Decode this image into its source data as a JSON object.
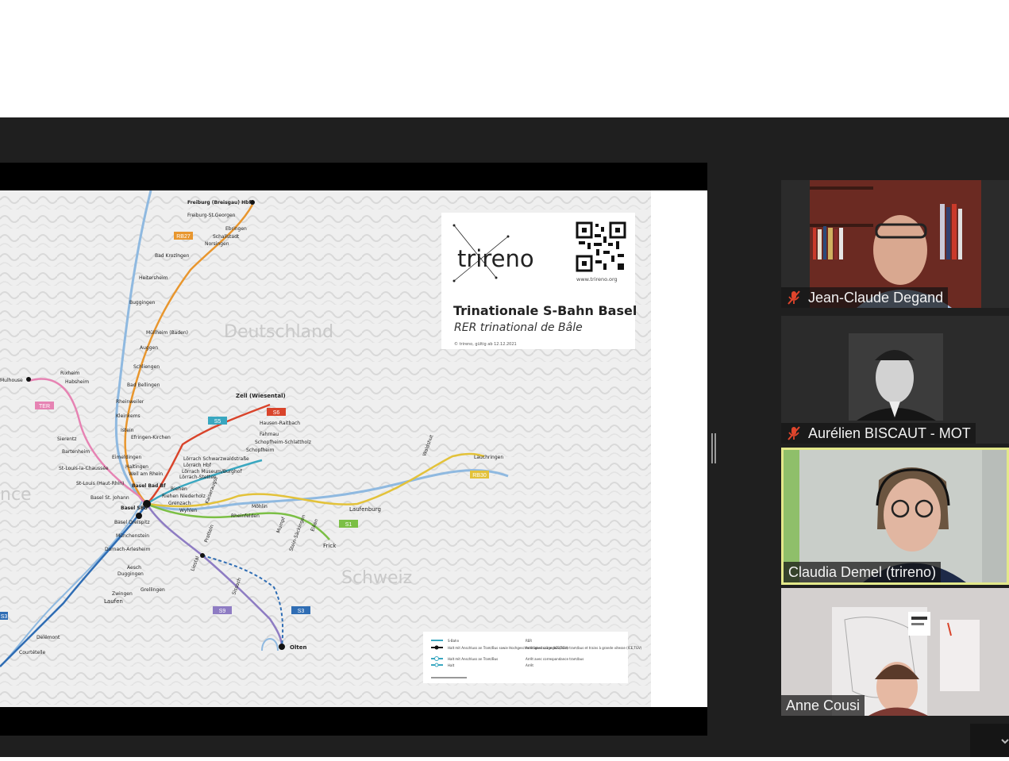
{
  "colors": {
    "meeting_bg": "#1f1f1f",
    "active_speaker_border": "#e3e88a",
    "mute_icon": "#e0452c",
    "line_orange": "#e8962e",
    "line_pink": "#e683b3",
    "line_green": "#7bbf45",
    "line_teal": "#39a7c0",
    "line_yellow": "#e3c23a",
    "line_red": "#d9442b",
    "line_purple": "#8e7cc3",
    "line_blue": "#2f6db4"
  },
  "shared_slide": {
    "logo_text": "trireno",
    "website": "www.trireno.org",
    "title": "Trinationale S-Bahn Basel",
    "subtitle": "RER trinational de Bâle",
    "validity": "© trireno, gültig ab 12.12.2021",
    "region_labels": {
      "germany": "Deutschland",
      "switzerland": "Schweiz",
      "france": "nce"
    },
    "line_badges": {
      "rb27": "RB27",
      "ter": "TER",
      "s5": "S5",
      "s6": "S6",
      "s1": "S1",
      "s3": "S3",
      "s9": "S9",
      "rb30": "RB30",
      "s3_left": "S3"
    },
    "stations": {
      "freiburg": "Freiburg (Breisgau) Hbf",
      "freiburg_st_georgen": "Freiburg-St.Georgen",
      "ebringen": "Ebringen",
      "schallstadt": "Schallstadt",
      "norsingen": "Norsingen",
      "bad_krozingen": "Bad Krozingen",
      "heitersheim": "Heitersheim",
      "buggingen": "Buggingen",
      "muellheim": "Müllheim (Baden)",
      "auggen": "Auggen",
      "schliengen": "Schliengen",
      "bad_bellingen": "Bad Bellingen",
      "rheinweiler": "Rheinweiler",
      "kleinkems": "Kleinkems",
      "istein": "Istein",
      "efringen": "Efringen-Kirchen",
      "eimeldingen": "Eimeldingen",
      "haltingen": "Haltingen",
      "weil_am_rhein": "Weil am Rhein",
      "basel_bad_bf": "Basel Bad Bf",
      "basel_sbb": "Basel SBB",
      "basel_st_johann": "Basel St. Johann",
      "basel_dreispitz": "Basel Dreispitz",
      "muenchenstein": "Münchenstein",
      "dornach": "Dornach-Arlesheim",
      "aesch": "Aesch",
      "duggingen": "Duggingen",
      "grellingen": "Grellingen",
      "zwingen": "Zwingen",
      "laufen": "Laufen",
      "delemont": "Delémont",
      "courtetelle": "Courtételle",
      "mulhouse": "Mulhouse",
      "rixheim": "Rixheim",
      "habsheim": "Habsheim",
      "sierentz": "Sierentz",
      "bartenheim": "Bartenheim",
      "st_louis_chaussee": "St-Louis-la-Chaussée",
      "st_louis": "St-Louis (Haut-Rhin)",
      "zell": "Zell (Wiesental)",
      "hausen": "Hausen-Raitbach",
      "fahrnau": "Fahrnau",
      "schopfheim_schlattholz": "Schopfheim-Schlattholz",
      "schopfheim": "Schopfheim",
      "loerrach_schwarzwaldstrasse": "Lörrach Schwarzwaldstraße",
      "loerrach_hbf": "Lörrach Hbf",
      "loerrach_museum": "Lörrach Museum/Burghof",
      "loerrach_stetten": "Lörrach-Stetten",
      "riehen": "Riehen",
      "riehen_niederholz": "Riehen Niederholz",
      "grenzach": "Grenzach",
      "wyhlen": "Wyhlen",
      "rheinfelden": "Rheinfelden",
      "mumpf": "Mumpf",
      "stein_saeckingen": "Stein-Säckingen",
      "eiken": "Eiken",
      "frick": "Frick",
      "laufenburg": "Laufenburg",
      "waldshut": "Waldshut",
      "lauchringen": "Lauchringen",
      "pratteln": "Pratteln",
      "liestal": "Liestal",
      "sissach": "Sissach",
      "olten": "Olten",
      "kaiseraugst": "Kaiseraugst",
      "moehlin": "Möhlin"
    },
    "legend": [
      {
        "de": "S-Bahn",
        "fr": "RER"
      },
      {
        "de": "Halt mit Anschluss an Tram/Bus sowie Hochgeschwindigkeitszüge (ICE,TGV)",
        "fr": "Arrêt avec correspondance tram/bus et trains à grande vitesse (ICE,TGV)"
      },
      {
        "de": "Halt mit Anschluss an Tram/Bus",
        "fr": "Arrêt avec correspondance tram/bus"
      },
      {
        "de": "Halt",
        "fr": "Arrêt"
      }
    ]
  },
  "participants": [
    {
      "name": "Jean-Claude Degand",
      "muted": true,
      "active": false
    },
    {
      "name": "Aurélien BISCAUT - MOT",
      "muted": true,
      "active": false
    },
    {
      "name": "Claudia Demel (trireno)",
      "muted": false,
      "active": true
    },
    {
      "name": "Anne Cousi",
      "muted": false,
      "active": false
    }
  ],
  "icons": {
    "mute": "microphone-muted-icon",
    "qr": "qr-code-icon",
    "chevron": "chevron-down-icon"
  }
}
